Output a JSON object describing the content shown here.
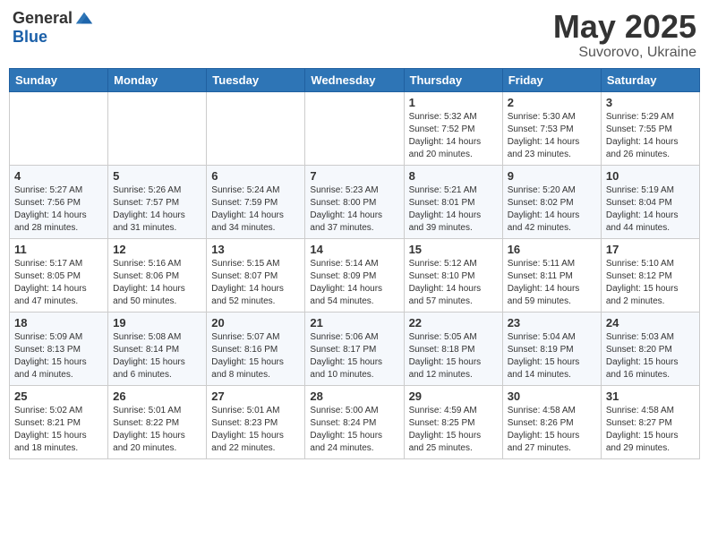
{
  "header": {
    "logo_general": "General",
    "logo_blue": "Blue",
    "title": "May 2025",
    "location": "Suvorovo, Ukraine"
  },
  "days_of_week": [
    "Sunday",
    "Monday",
    "Tuesday",
    "Wednesday",
    "Thursday",
    "Friday",
    "Saturday"
  ],
  "weeks": [
    [
      {
        "day": "",
        "info": ""
      },
      {
        "day": "",
        "info": ""
      },
      {
        "day": "",
        "info": ""
      },
      {
        "day": "",
        "info": ""
      },
      {
        "day": "1",
        "info": "Sunrise: 5:32 AM\nSunset: 7:52 PM\nDaylight: 14 hours\nand 20 minutes."
      },
      {
        "day": "2",
        "info": "Sunrise: 5:30 AM\nSunset: 7:53 PM\nDaylight: 14 hours\nand 23 minutes."
      },
      {
        "day": "3",
        "info": "Sunrise: 5:29 AM\nSunset: 7:55 PM\nDaylight: 14 hours\nand 26 minutes."
      }
    ],
    [
      {
        "day": "4",
        "info": "Sunrise: 5:27 AM\nSunset: 7:56 PM\nDaylight: 14 hours\nand 28 minutes."
      },
      {
        "day": "5",
        "info": "Sunrise: 5:26 AM\nSunset: 7:57 PM\nDaylight: 14 hours\nand 31 minutes."
      },
      {
        "day": "6",
        "info": "Sunrise: 5:24 AM\nSunset: 7:59 PM\nDaylight: 14 hours\nand 34 minutes."
      },
      {
        "day": "7",
        "info": "Sunrise: 5:23 AM\nSunset: 8:00 PM\nDaylight: 14 hours\nand 37 minutes."
      },
      {
        "day": "8",
        "info": "Sunrise: 5:21 AM\nSunset: 8:01 PM\nDaylight: 14 hours\nand 39 minutes."
      },
      {
        "day": "9",
        "info": "Sunrise: 5:20 AM\nSunset: 8:02 PM\nDaylight: 14 hours\nand 42 minutes."
      },
      {
        "day": "10",
        "info": "Sunrise: 5:19 AM\nSunset: 8:04 PM\nDaylight: 14 hours\nand 44 minutes."
      }
    ],
    [
      {
        "day": "11",
        "info": "Sunrise: 5:17 AM\nSunset: 8:05 PM\nDaylight: 14 hours\nand 47 minutes."
      },
      {
        "day": "12",
        "info": "Sunrise: 5:16 AM\nSunset: 8:06 PM\nDaylight: 14 hours\nand 50 minutes."
      },
      {
        "day": "13",
        "info": "Sunrise: 5:15 AM\nSunset: 8:07 PM\nDaylight: 14 hours\nand 52 minutes."
      },
      {
        "day": "14",
        "info": "Sunrise: 5:14 AM\nSunset: 8:09 PM\nDaylight: 14 hours\nand 54 minutes."
      },
      {
        "day": "15",
        "info": "Sunrise: 5:12 AM\nSunset: 8:10 PM\nDaylight: 14 hours\nand 57 minutes."
      },
      {
        "day": "16",
        "info": "Sunrise: 5:11 AM\nSunset: 8:11 PM\nDaylight: 14 hours\nand 59 minutes."
      },
      {
        "day": "17",
        "info": "Sunrise: 5:10 AM\nSunset: 8:12 PM\nDaylight: 15 hours\nand 2 minutes."
      }
    ],
    [
      {
        "day": "18",
        "info": "Sunrise: 5:09 AM\nSunset: 8:13 PM\nDaylight: 15 hours\nand 4 minutes."
      },
      {
        "day": "19",
        "info": "Sunrise: 5:08 AM\nSunset: 8:14 PM\nDaylight: 15 hours\nand 6 minutes."
      },
      {
        "day": "20",
        "info": "Sunrise: 5:07 AM\nSunset: 8:16 PM\nDaylight: 15 hours\nand 8 minutes."
      },
      {
        "day": "21",
        "info": "Sunrise: 5:06 AM\nSunset: 8:17 PM\nDaylight: 15 hours\nand 10 minutes."
      },
      {
        "day": "22",
        "info": "Sunrise: 5:05 AM\nSunset: 8:18 PM\nDaylight: 15 hours\nand 12 minutes."
      },
      {
        "day": "23",
        "info": "Sunrise: 5:04 AM\nSunset: 8:19 PM\nDaylight: 15 hours\nand 14 minutes."
      },
      {
        "day": "24",
        "info": "Sunrise: 5:03 AM\nSunset: 8:20 PM\nDaylight: 15 hours\nand 16 minutes."
      }
    ],
    [
      {
        "day": "25",
        "info": "Sunrise: 5:02 AM\nSunset: 8:21 PM\nDaylight: 15 hours\nand 18 minutes."
      },
      {
        "day": "26",
        "info": "Sunrise: 5:01 AM\nSunset: 8:22 PM\nDaylight: 15 hours\nand 20 minutes."
      },
      {
        "day": "27",
        "info": "Sunrise: 5:01 AM\nSunset: 8:23 PM\nDaylight: 15 hours\nand 22 minutes."
      },
      {
        "day": "28",
        "info": "Sunrise: 5:00 AM\nSunset: 8:24 PM\nDaylight: 15 hours\nand 24 minutes."
      },
      {
        "day": "29",
        "info": "Sunrise: 4:59 AM\nSunset: 8:25 PM\nDaylight: 15 hours\nand 25 minutes."
      },
      {
        "day": "30",
        "info": "Sunrise: 4:58 AM\nSunset: 8:26 PM\nDaylight: 15 hours\nand 27 minutes."
      },
      {
        "day": "31",
        "info": "Sunrise: 4:58 AM\nSunset: 8:27 PM\nDaylight: 15 hours\nand 29 minutes."
      }
    ]
  ]
}
